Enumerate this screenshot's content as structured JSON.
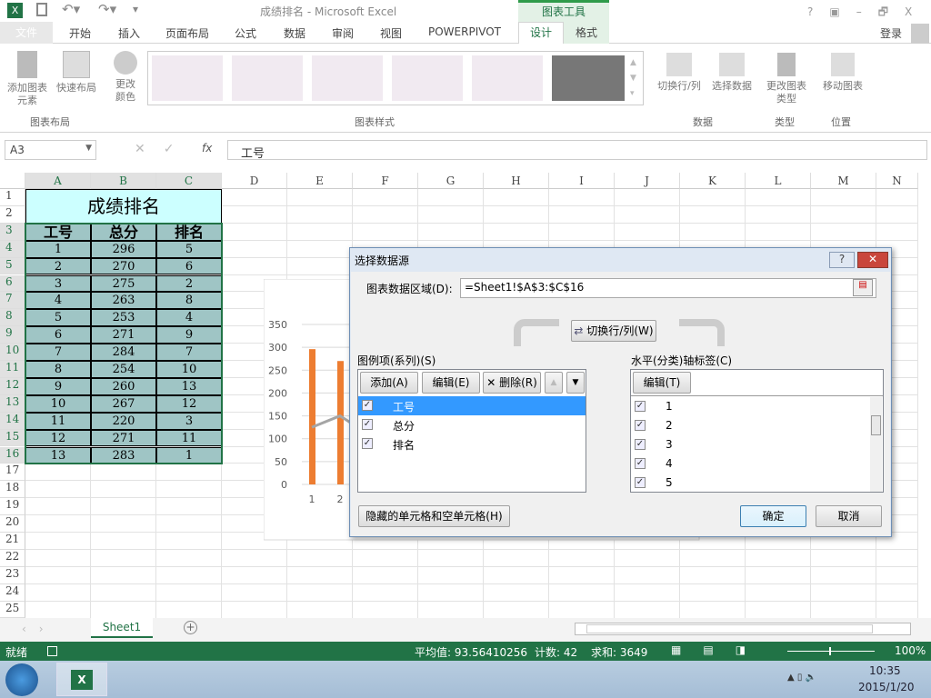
{
  "window": {
    "title": "成绩排名 - Microsoft Excel",
    "context_tab": "图表工具",
    "controls": [
      "?",
      "▣",
      "–",
      "🗗",
      "X"
    ]
  },
  "tabs": [
    "文件",
    "开始",
    "插入",
    "页面布局",
    "公式",
    "数据",
    "审阅",
    "视图",
    "POWERPIVOT",
    "设计",
    "格式"
  ],
  "active_tab": "设计",
  "signin": "登录",
  "ribbon": {
    "buttons": [
      "添加图表元素",
      "快速布局",
      "更改颜色",
      "切换行/列",
      "选择数据",
      "更改图表类型",
      "移动图表"
    ],
    "groups": [
      "图表布局",
      "图表样式",
      "数据",
      "类型",
      "位置"
    ]
  },
  "formula_bar": {
    "name_box": "A3",
    "fx": "fx",
    "value": "工号"
  },
  "columns": [
    "A",
    "B",
    "C",
    "D",
    "E",
    "F",
    "G",
    "H",
    "I",
    "J",
    "K",
    "L",
    "M",
    "N"
  ],
  "rows": [
    "1",
    "2",
    "3",
    "4",
    "5",
    "6",
    "7",
    "8",
    "9",
    "10",
    "11",
    "12",
    "13",
    "14",
    "15",
    "16",
    "17",
    "18",
    "19",
    "20",
    "21",
    "22",
    "23",
    "24",
    "25"
  ],
  "table": {
    "title": "成绩排名",
    "headers": [
      "工号",
      "总分",
      "排名"
    ],
    "data": [
      [
        "1",
        "296",
        "5"
      ],
      [
        "2",
        "270",
        "6"
      ],
      [
        "3",
        "275",
        "2"
      ],
      [
        "4",
        "263",
        "8"
      ],
      [
        "5",
        "253",
        "4"
      ],
      [
        "6",
        "271",
        "9"
      ],
      [
        "7",
        "284",
        "7"
      ],
      [
        "8",
        "254",
        "10"
      ],
      [
        "9",
        "260",
        "13"
      ],
      [
        "10",
        "267",
        "12"
      ],
      [
        "11",
        "220",
        "3"
      ],
      [
        "12",
        "271",
        "11"
      ],
      [
        "13",
        "283",
        "1"
      ]
    ]
  },
  "chart_data": {
    "type": "bar",
    "categories": [
      "1",
      "2"
    ],
    "series": [
      {
        "type": "bar",
        "values": [
          296,
          270
        ],
        "color": "#ed7d31"
      },
      {
        "type": "line",
        "values": [
          125,
          150
        ],
        "color": "#a5a5a5"
      }
    ],
    "yticks": [
      "0",
      "50",
      "100",
      "150",
      "200",
      "250",
      "300",
      "350"
    ],
    "ylim": [
      0,
      350
    ],
    "grid": true
  },
  "dialog": {
    "title": "选择数据源",
    "range_label": "图表数据区域(D):",
    "range_value": "=Sheet1!$A$3:$C$16",
    "switch_button": "切换行/列(W)",
    "series_label": "图例项(系列)(S)",
    "add": "添加(A)",
    "edit": "编辑(E)",
    "delete": "删除(R)",
    "series": [
      "工号",
      "总分",
      "排名"
    ],
    "axis_label": "水平(分类)轴标签(C)",
    "axis_edit": "编辑(T)",
    "axis_items": [
      "1",
      "2",
      "3",
      "4",
      "5"
    ],
    "hidden_cells": "隐藏的单元格和空单元格(H)",
    "ok": "确定",
    "cancel": "取消"
  },
  "sheet_tab": "Sheet1",
  "status": {
    "ready": "就绪",
    "average": "平均值: 93.56410256",
    "count": "计数: 42",
    "sum": "求和: 3649",
    "zoom": "100%"
  },
  "taskbar": {
    "time": "10:35",
    "date": "2015/1/20"
  },
  "colors": {
    "excel_green": "#217346",
    "header_fill": "#9fc5c5",
    "title_fill": "#ccffff",
    "selection": "#3399ff"
  }
}
